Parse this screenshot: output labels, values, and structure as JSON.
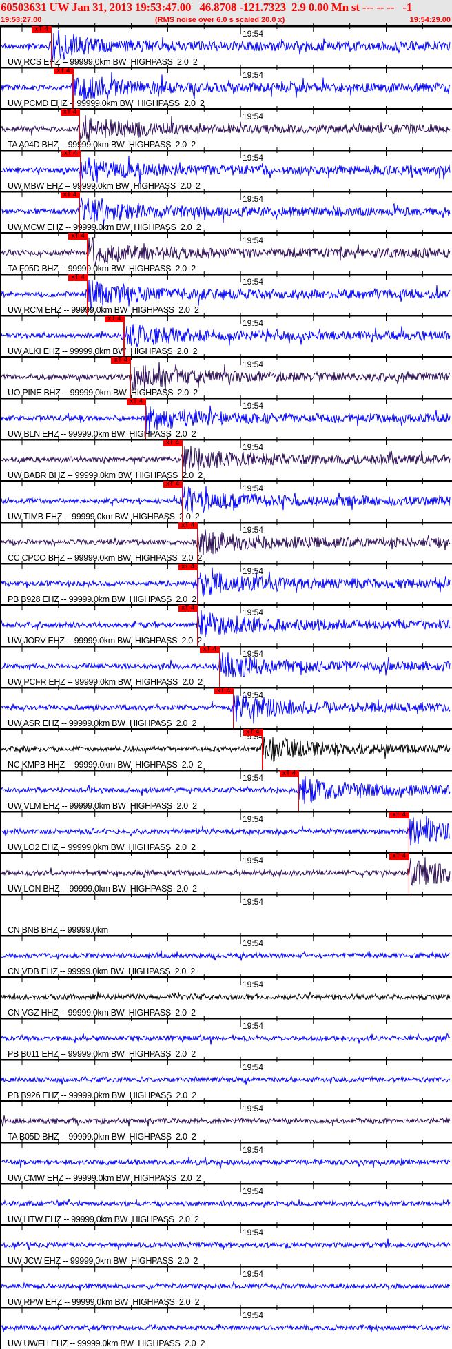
{
  "header": {
    "title": "60503631 UW Jan 31, 2013 19:53:47.00   46.8708 -121.7323  2.9 0.00 Mn st --- -- --   -1",
    "start_time": "19:53:27.00",
    "note": "(RMS noise over 6.0 s scaled 20.0 x)",
    "end_time": "19:54:29.00"
  },
  "axis": {
    "tick_label": "19:54",
    "tick_label_offset_s": 33,
    "window_s": 62
  },
  "colors": {
    "header_text": "#ff0000",
    "pick": "#ff0000",
    "blue": "#0000ff",
    "purple": "#2a0a55",
    "black": "#000000"
  },
  "pick_label": "xT 4",
  "traces": [
    {
      "label": "UW RCS EHZ -- 99999.0km BW  HIGHPASS  2.0  2",
      "color": "blue",
      "pick_s": 7.0
    },
    {
      "label": "UW PCMD EHZ -- 99999.0km BW  HIGHPASS  2.0  2",
      "color": "blue",
      "pick_s": 10.0
    },
    {
      "label": "TA A04D BHZ -- 99999.0km BW  HIGHPASS  2.0  2",
      "color": "purple",
      "pick_s": 10.9
    },
    {
      "label": "UW MBW EHZ -- 99999.0km BW  HIGHPASS  2.0  2",
      "color": "blue",
      "pick_s": 11.0
    },
    {
      "label": "UW MCW EHZ -- 99999.0km BW  HIGHPASS  2.0  2",
      "color": "blue",
      "pick_s": 10.9
    },
    {
      "label": "TA F05D BHZ -- 99999.0km BW  HIGHPASS  2.0  2",
      "color": "purple",
      "pick_s": 12.0
    },
    {
      "label": "UW RCM EHZ -- 99999.0km BW  HIGHPASS  2.0  2",
      "color": "blue",
      "pick_s": 12.0
    },
    {
      "label": "UW ALKI EHZ -- 99999.0km BW  HIGHPASS  2.0  2",
      "color": "blue",
      "pick_s": 17.0
    },
    {
      "label": "UO PINE BHZ -- 99999.0km BW  HIGHPASS  2.0  2",
      "color": "purple",
      "pick_s": 17.9
    },
    {
      "label": "UW BLN EHZ -- 99999.0km BW  HIGHPASS  2.0  2",
      "color": "blue",
      "pick_s": 20.0
    },
    {
      "label": "UW BABR BHZ -- 99999.0km BW  HIGHPASS  2.0  2",
      "color": "purple",
      "pick_s": 25.0
    },
    {
      "label": "UW TIMB EHZ -- 99999.0km BW  HIGHPASS  2.0  2",
      "color": "blue",
      "pick_s": 25.0
    },
    {
      "label": "CC CPCO BHZ -- 99999.0km BW  HIGHPASS  2.0  2",
      "color": "purple",
      "pick_s": 27.1
    },
    {
      "label": "PB B928 EHZ -- 99999.0km BW  HIGHPASS  2.0  2",
      "color": "blue",
      "pick_s": 27.1
    },
    {
      "label": "UW JORV EHZ -- 99999.0km BW  HIGHPASS  2.0  2",
      "color": "blue",
      "pick_s": 27.1
    },
    {
      "label": "UW PCFR EHZ -- 99999.0km BW  HIGHPASS  2.0  2",
      "color": "blue",
      "pick_s": 30.1
    },
    {
      "label": "UW ASR EHZ -- 99999.0km BW  HIGHPASS  2.0  2",
      "color": "blue",
      "pick_s": 32.0
    },
    {
      "label": "NC KMPB HHZ -- 99999.0km BW  HIGHPASS  2.0  2",
      "color": "black",
      "pick_s": 36.0
    },
    {
      "label": "UW VLM EHZ -- 99999.0km BW  HIGHPASS  2.0  2",
      "color": "blue",
      "pick_s": 41.0
    },
    {
      "label": "UW LO2 EHZ -- 99999.0km BW  HIGHPASS  2.0  2",
      "color": "blue",
      "pick_s": 56.1
    },
    {
      "label": "UW LON BHZ -- 99999.0km BW  HIGHPASS  2.0  2",
      "color": "purple",
      "pick_s": 56.1
    },
    {
      "label": "CN BNB BHZ -- 99999.0km",
      "color": "none",
      "pick_s": null
    },
    {
      "label": "CN VDB EHZ -- 99999.0km BW  HIGHPASS  2.0  2",
      "color": "blue",
      "pick_s": null
    },
    {
      "label": "CN VGZ HHZ -- 99999.0km BW  HIGHPASS  2.0  2",
      "color": "black",
      "pick_s": null
    },
    {
      "label": "PB B011 EHZ -- 99999.0km BW  HIGHPASS  2.0  2",
      "color": "blue",
      "pick_s": null
    },
    {
      "label": "PB B926 EHZ -- 99999.0km BW  HIGHPASS  2.0  2",
      "color": "blue",
      "pick_s": null
    },
    {
      "label": "TA B05D BHZ -- 99999.0km BW  HIGHPASS  2.0  2",
      "color": "purple",
      "pick_s": null
    },
    {
      "label": "UW CMW EHZ -- 99999.0km BW  HIGHPASS  2.0  2",
      "color": "blue",
      "pick_s": null
    },
    {
      "label": "UW HTW EHZ -- 99999.0km BW  HIGHPASS  2.0  2",
      "color": "blue",
      "pick_s": null
    },
    {
      "label": "UW JCW EHZ -- 99999.0km BW  HIGHPASS  2.0  2",
      "color": "blue",
      "pick_s": null
    },
    {
      "label": "UW RPW EHZ -- 99999.0km BW  HIGHPASS  2.0  2",
      "color": "blue",
      "pick_s": null
    },
    {
      "label": "UW UWFH EHZ -- 99999.0km BW  HIGHPASS  2.0  2",
      "color": "blue",
      "pick_s": null
    }
  ]
}
